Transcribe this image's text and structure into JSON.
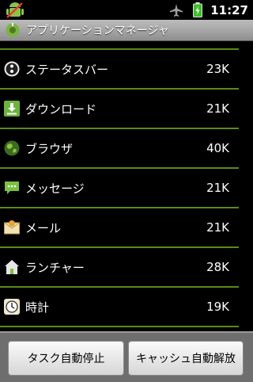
{
  "status": {
    "time": "11:27"
  },
  "title": "アプリケーションマネージャ",
  "apps": [
    {
      "name": "ステータスバー",
      "size": "23K",
      "icon": "statusbar-icon"
    },
    {
      "name": "ダウンロード",
      "size": "21K",
      "icon": "download-icon"
    },
    {
      "name": "ブラウザ",
      "size": "40K",
      "icon": "browser-globe-icon"
    },
    {
      "name": "メッセージ",
      "size": "21K",
      "icon": "message-icon"
    },
    {
      "name": "メール",
      "size": "21K",
      "icon": "mail-icon"
    },
    {
      "name": "ランチャー",
      "size": "28K",
      "icon": "launcher-home-icon"
    },
    {
      "name": "時計",
      "size": "19K",
      "icon": "clock-icon"
    }
  ],
  "buttons": {
    "auto_stop": "タスク自動停止",
    "auto_release_cache": "キャッシュ自動解放"
  }
}
